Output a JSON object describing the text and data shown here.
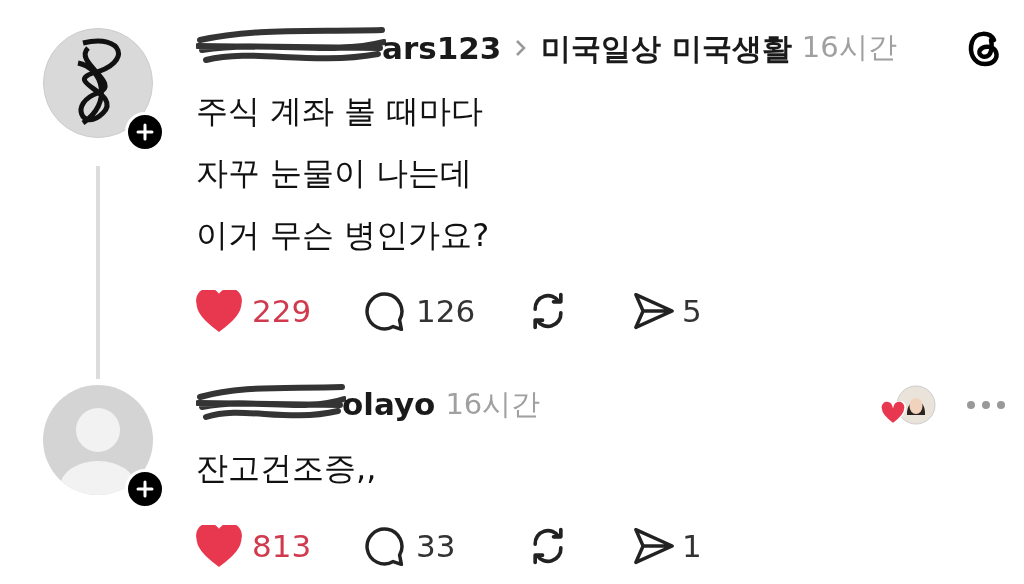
{
  "posts": [
    {
      "avatar": {
        "kind": "photo"
      },
      "username": "ars123",
      "topic": "미국일상 미국생활",
      "time": "16시간",
      "lines": [
        "주식 계좌 볼 때마다",
        "자꾸 눈물이 나는데",
        "이거 무슨 병인가요?"
      ],
      "liked": true,
      "likes": "229",
      "replies": "126",
      "shares": "5",
      "thread_line": true,
      "author_liked": false
    },
    {
      "avatar": {
        "kind": "default"
      },
      "username": "olayo",
      "time": "16시간",
      "lines": [
        "잔고건조증,,"
      ],
      "liked": true,
      "likes": "813",
      "replies": "33",
      "shares": "1",
      "thread_line": false,
      "author_liked": true
    }
  ]
}
